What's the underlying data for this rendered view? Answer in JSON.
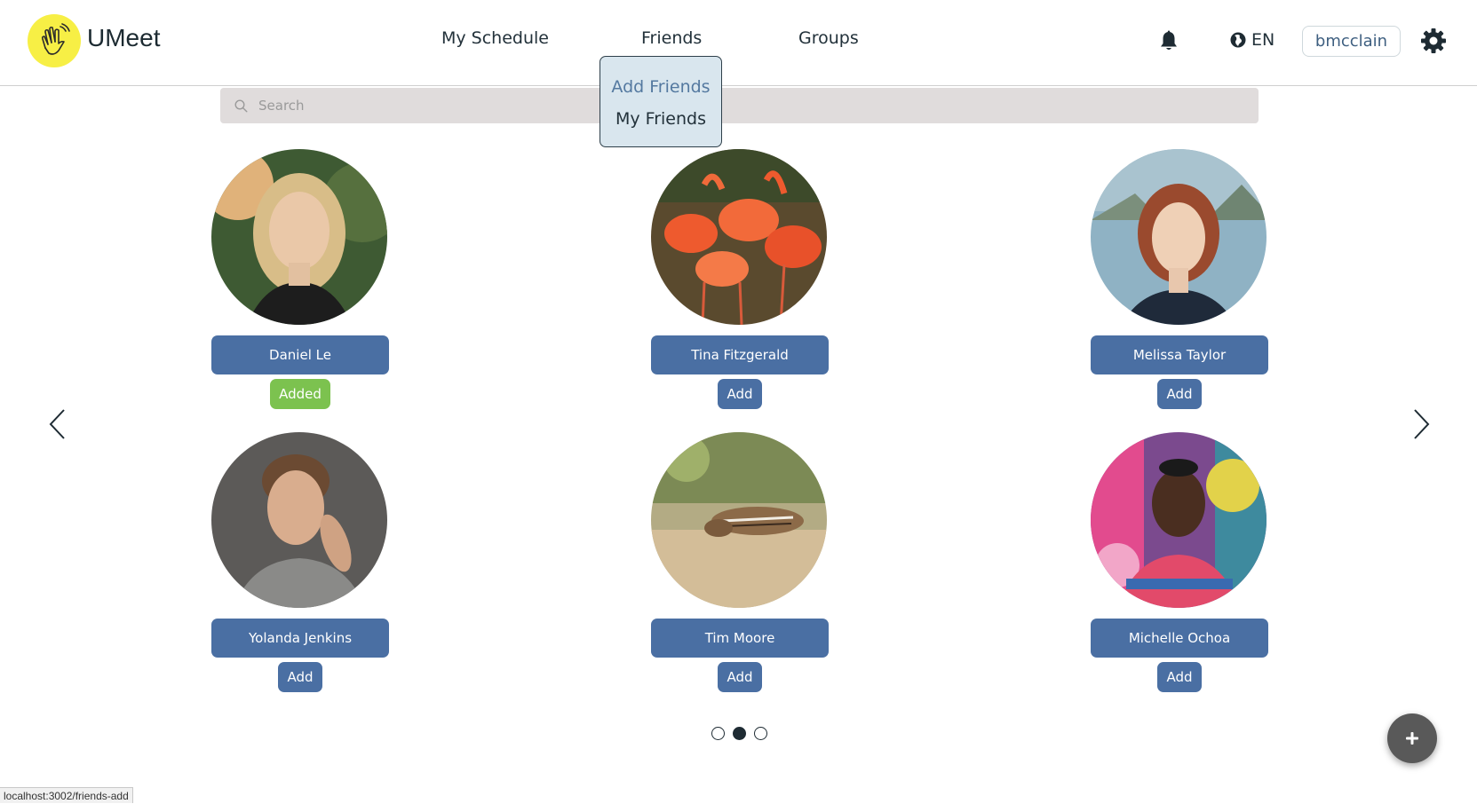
{
  "app": {
    "name": "UMeet"
  },
  "header": {
    "nav": [
      "My Schedule",
      "Friends",
      "Groups"
    ],
    "language": "EN",
    "username": "bmcclain"
  },
  "friends_menu": {
    "items": [
      "Add Friends",
      "My Friends"
    ]
  },
  "search": {
    "placeholder": "Search"
  },
  "people": [
    {
      "name": "Daniel Le",
      "action": "Added",
      "status": "added"
    },
    {
      "name": "Tina Fitzgerald",
      "action": "Add",
      "status": "add"
    },
    {
      "name": "Melissa Taylor",
      "action": "Add",
      "status": "add"
    },
    {
      "name": "Yolanda Jenkins",
      "action": "Add",
      "status": "add"
    },
    {
      "name": "Tim Moore",
      "action": "Add",
      "status": "add"
    },
    {
      "name": "Michelle Ochoa",
      "action": "Add",
      "status": "add"
    }
  ],
  "carousel": {
    "pages": 3,
    "active_page": 2
  },
  "status_url": "localhost:3002/friends-add",
  "colors": {
    "primary": "#4a6fa3",
    "added": "#7cc24f",
    "logo": "#f7ef45",
    "dropdown_bg": "#d9e6ee",
    "fab": "#595959"
  },
  "icons": {
    "logo": "waving-hand-icon",
    "notifications": "bell-icon",
    "language": "globe-icon",
    "settings": "gear-icon",
    "search": "search-icon",
    "prev": "chevron-left-icon",
    "next": "chevron-right-icon",
    "fab": "plus-icon"
  }
}
